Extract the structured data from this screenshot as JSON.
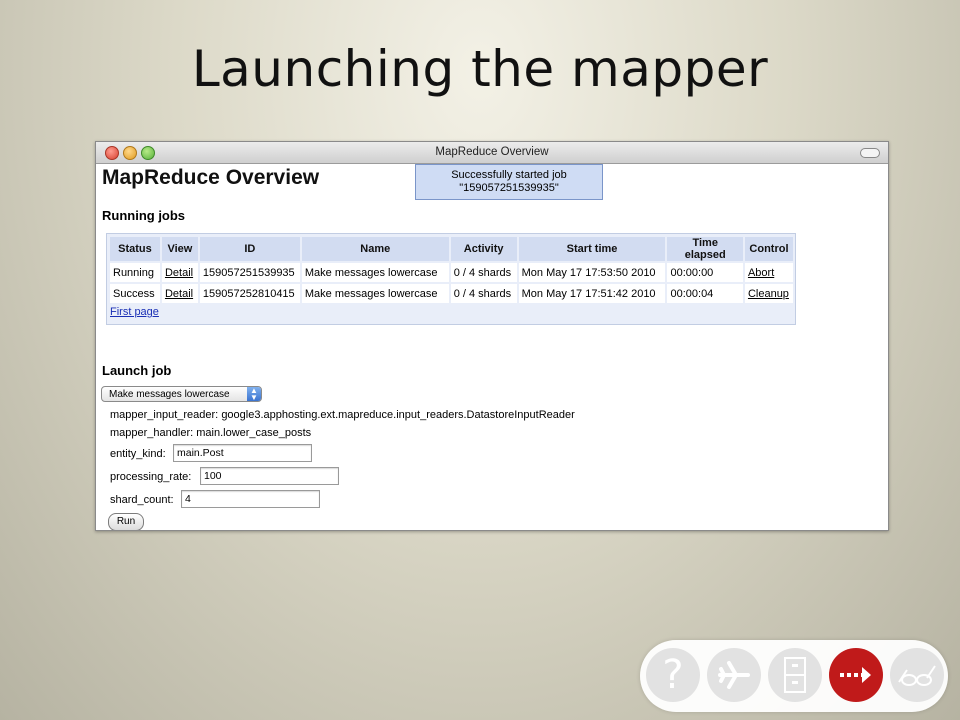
{
  "slide": {
    "title": "Launching the mapper"
  },
  "window": {
    "title": "MapReduce Overview"
  },
  "app": {
    "title": "MapReduce Overview",
    "notice_line1": "Successfully started job",
    "notice_line2": "\"159057251539935\""
  },
  "running_jobs": {
    "heading": "Running jobs",
    "columns": [
      "Status",
      "View",
      "ID",
      "Name",
      "Activity",
      "Start time",
      "Time elapsed",
      "Control"
    ],
    "rows": [
      {
        "status": "Running",
        "view": "Detail",
        "id": "159057251539935",
        "name": "Make messages lowercase",
        "activity": "0 / 4 shards",
        "start": "Mon May 17 17:53:50 2010",
        "elapsed": "00:00:00",
        "control": "Abort"
      },
      {
        "status": "Success",
        "view": "Detail",
        "id": "159057252810415",
        "name": "Make messages lowercase",
        "activity": "0 / 4 shards",
        "start": "Mon May 17 17:51:42 2010",
        "elapsed": "00:00:04",
        "control": "Cleanup"
      }
    ],
    "first_page": "First page"
  },
  "launch": {
    "heading": "Launch job",
    "selected_job": "Make messages lowercase",
    "reader_label": "mapper_input_reader:",
    "reader_value": "google3.apphosting.ext.mapreduce.input_readers.DatastoreInputReader",
    "handler_label": "mapper_handler:",
    "handler_value": "main.lower_case_posts",
    "entity_kind_label": "entity_kind:",
    "entity_kind_value": "main.Post",
    "processing_rate_label": "processing_rate:",
    "processing_rate_value": "100",
    "shard_count_label": "shard_count:",
    "shard_count_value": "4",
    "run_label": "Run"
  },
  "nav": {
    "question_glyph": "?",
    "items": [
      "question-icon",
      "airplane-icon",
      "cabinet-icon",
      "forward-arrow-icon",
      "glasses-icon"
    ],
    "active_color": "#c01a1a"
  }
}
